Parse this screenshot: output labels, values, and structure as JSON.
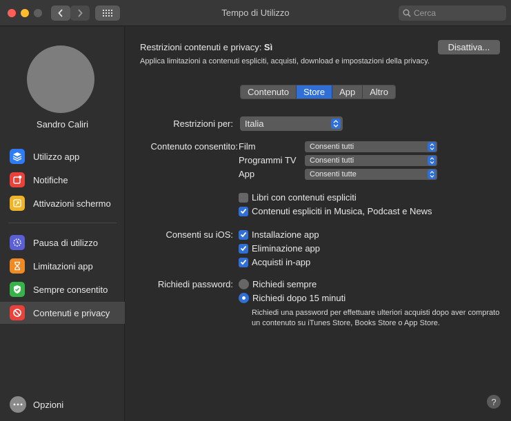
{
  "window": {
    "title": "Tempo di Utilizzo"
  },
  "search": {
    "placeholder": "Cerca"
  },
  "sidebar": {
    "user_name": "Sandro Caliri",
    "items": [
      {
        "label": "Utilizzo app",
        "icon": "layers-icon",
        "color": "#2f7bf6"
      },
      {
        "label": "Notifiche",
        "icon": "notification-icon",
        "color": "#e8423a"
      },
      {
        "label": "Attivazioni schermo",
        "icon": "screen-wake-icon",
        "color": "#f0b429"
      },
      {
        "label": "Pausa di utilizzo",
        "icon": "moon-clock-icon",
        "color": "#5b5fd6"
      },
      {
        "label": "Limitazioni app",
        "icon": "hourglass-icon",
        "color": "#f08a24"
      },
      {
        "label": "Sempre consentito",
        "icon": "check-shield-icon",
        "color": "#38b34a"
      },
      {
        "label": "Contenuti e privacy",
        "icon": "no-entry-icon",
        "color": "#e8423a"
      }
    ],
    "options_label": "Opzioni"
  },
  "main": {
    "restrictions_label": "Restrizioni contenuti e privacy: ",
    "restrictions_state": "Sì",
    "restrictions_desc": "Applica limitazioni a contenuti espliciti, acquisti, download e impostazioni della privacy.",
    "disable_button": "Disattiva...",
    "tabs": [
      "Contenuto",
      "Store",
      "App",
      "Altro"
    ],
    "active_tab": "Store",
    "restrict_for_label": "Restrizioni per:",
    "restrict_for_value": "Italia",
    "allowed_content_label": "Contenuto consentito:",
    "allowed_content": [
      {
        "label": "Film",
        "value": "Consenti tutti"
      },
      {
        "label": "Programmi TV",
        "value": "Consenti tutti"
      },
      {
        "label": "App",
        "value": "Consenti tutte"
      }
    ],
    "explicit_books": {
      "label": "Libri con contenuti espliciti",
      "checked": false
    },
    "explicit_music": {
      "label": "Contenuti espliciti in Musica, Podcast e News",
      "checked": true
    },
    "ios_label": "Consenti su iOS:",
    "ios_options": [
      {
        "label": "Installazione app",
        "checked": true
      },
      {
        "label": "Eliminazione app",
        "checked": true
      },
      {
        "label": "Acquisti in-app",
        "checked": true
      }
    ],
    "password_label": "Richiedi password:",
    "password_options": [
      {
        "label": "Richiedi sempre",
        "selected": false
      },
      {
        "label": "Richiedi dopo 15 minuti",
        "selected": true
      }
    ],
    "password_desc": "Richiedi una password per effettuare ulteriori acquisti dopo aver comprato un contenuto su iTunes Store, Books Store o App Store.",
    "help": "?"
  }
}
